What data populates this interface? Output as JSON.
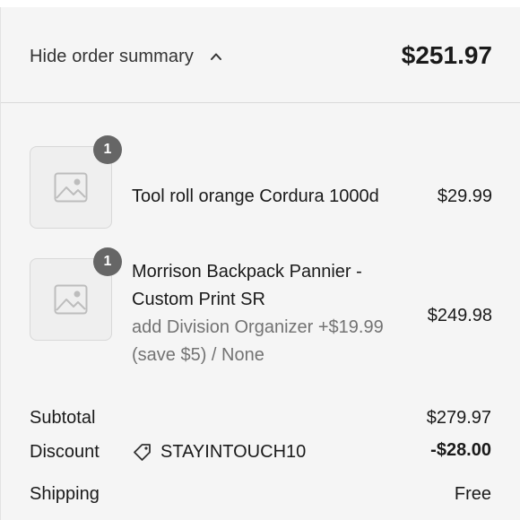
{
  "summary": {
    "toggle_label": "Hide order summary",
    "total": "$251.97"
  },
  "items": [
    {
      "quantity": "1",
      "name_lines": [
        "Tool roll orange Cordura 1000d"
      ],
      "variant_lines": [],
      "price": "$29.99",
      "image_icon": "image-placeholder-icon"
    },
    {
      "quantity": "1",
      "name_lines": [
        "Morrison Backpack Pannier -",
        "Custom Print SR"
      ],
      "variant_lines": [
        "add Division Organizer +$19.99",
        "(save $5) / None"
      ],
      "price": "$249.98",
      "image_icon": "image-placeholder-icon"
    }
  ],
  "totals": {
    "subtotal_label": "Subtotal",
    "subtotal_value": "$279.97",
    "discount_label": "Discount",
    "discount_code": "STAYINTOUCH10",
    "discount_icon": "tag-icon",
    "discount_value": "-$28.00",
    "shipping_label": "Shipping",
    "shipping_value": "Free"
  },
  "colors": {
    "panel_background": "#f5f5f5",
    "badge_background": "#666666",
    "muted_text": "#737373"
  }
}
